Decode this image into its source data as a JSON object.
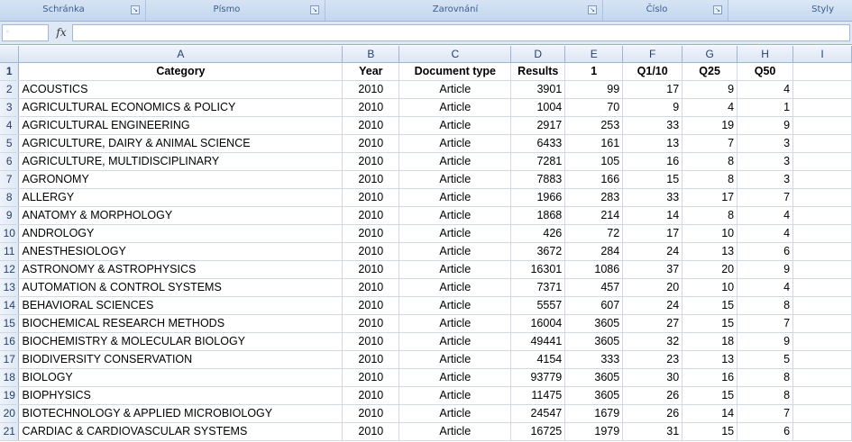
{
  "ribbon": {
    "groups": [
      "Schránka",
      "Písmo",
      "Zarovnání",
      "Číslo"
    ],
    "styles_label": "Styly"
  },
  "formula_bar": {
    "fx_label": "fx",
    "name_box": "",
    "formula": ""
  },
  "columns": [
    "A",
    "B",
    "C",
    "D",
    "E",
    "F",
    "G",
    "H",
    "I"
  ],
  "header_row": {
    "num": "1",
    "cells": [
      "Category",
      "Year",
      "Document type",
      "Results",
      "1",
      "Q1/10",
      "Q25",
      "Q50",
      ""
    ]
  },
  "rows": [
    {
      "num": "2",
      "cells": [
        "ACOUSTICS",
        "2010",
        "Article",
        "3901",
        "99",
        "17",
        "9",
        "4"
      ]
    },
    {
      "num": "3",
      "cells": [
        "AGRICULTURAL ECONOMICS & POLICY",
        "2010",
        "Article",
        "1004",
        "70",
        "9",
        "4",
        "1"
      ]
    },
    {
      "num": "4",
      "cells": [
        "AGRICULTURAL ENGINEERING",
        "2010",
        "Article",
        "2917",
        "253",
        "33",
        "19",
        "9"
      ]
    },
    {
      "num": "5",
      "cells": [
        "AGRICULTURE, DAIRY & ANIMAL SCIENCE",
        "2010",
        "Article",
        "6433",
        "161",
        "13",
        "7",
        "3"
      ]
    },
    {
      "num": "6",
      "cells": [
        "AGRICULTURE, MULTIDISCIPLINARY",
        "2010",
        "Article",
        "7281",
        "105",
        "16",
        "8",
        "3"
      ]
    },
    {
      "num": "7",
      "cells": [
        "AGRONOMY",
        "2010",
        "Article",
        "7883",
        "166",
        "15",
        "8",
        "3"
      ]
    },
    {
      "num": "8",
      "cells": [
        "ALLERGY",
        "2010",
        "Article",
        "1966",
        "283",
        "33",
        "17",
        "7"
      ]
    },
    {
      "num": "9",
      "cells": [
        "ANATOMY & MORPHOLOGY",
        "2010",
        "Article",
        "1868",
        "214",
        "14",
        "8",
        "4"
      ]
    },
    {
      "num": "10",
      "cells": [
        "ANDROLOGY",
        "2010",
        "Article",
        "426",
        "72",
        "17",
        "10",
        "4"
      ]
    },
    {
      "num": "11",
      "cells": [
        "ANESTHESIOLOGY",
        "2010",
        "Article",
        "3672",
        "284",
        "24",
        "13",
        "6"
      ]
    },
    {
      "num": "12",
      "cells": [
        "ASTRONOMY & ASTROPHYSICS",
        "2010",
        "Article",
        "16301",
        "1086",
        "37",
        "20",
        "9"
      ]
    },
    {
      "num": "13",
      "cells": [
        "AUTOMATION & CONTROL SYSTEMS",
        "2010",
        "Article",
        "7371",
        "457",
        "20",
        "10",
        "4"
      ]
    },
    {
      "num": "14",
      "cells": [
        "BEHAVIORAL SCIENCES",
        "2010",
        "Article",
        "5557",
        "607",
        "24",
        "15",
        "8"
      ]
    },
    {
      "num": "15",
      "cells": [
        "BIOCHEMICAL RESEARCH METHODS",
        "2010",
        "Article",
        "16004",
        "3605",
        "27",
        "15",
        "7"
      ]
    },
    {
      "num": "16",
      "cells": [
        "BIOCHEMISTRY & MOLECULAR BIOLOGY",
        "2010",
        "Article",
        "49441",
        "3605",
        "32",
        "18",
        "9"
      ]
    },
    {
      "num": "17",
      "cells": [
        "BIODIVERSITY CONSERVATION",
        "2010",
        "Article",
        "4154",
        "333",
        "23",
        "13",
        "5"
      ]
    },
    {
      "num": "18",
      "cells": [
        "BIOLOGY",
        "2010",
        "Article",
        "93779",
        "3605",
        "30",
        "16",
        "8"
      ]
    },
    {
      "num": "19",
      "cells": [
        "BIOPHYSICS",
        "2010",
        "Article",
        "11475",
        "3605",
        "26",
        "15",
        "8"
      ]
    },
    {
      "num": "20",
      "cells": [
        "BIOTECHNOLOGY & APPLIED MICROBIOLOGY",
        "2010",
        "Article",
        "24547",
        "1679",
        "26",
        "14",
        "7"
      ]
    },
    {
      "num": "21",
      "cells": [
        "CARDIAC & CARDIOVASCULAR SYSTEMS",
        "2010",
        "Article",
        "16725",
        "1979",
        "31",
        "15",
        "6"
      ]
    }
  ]
}
